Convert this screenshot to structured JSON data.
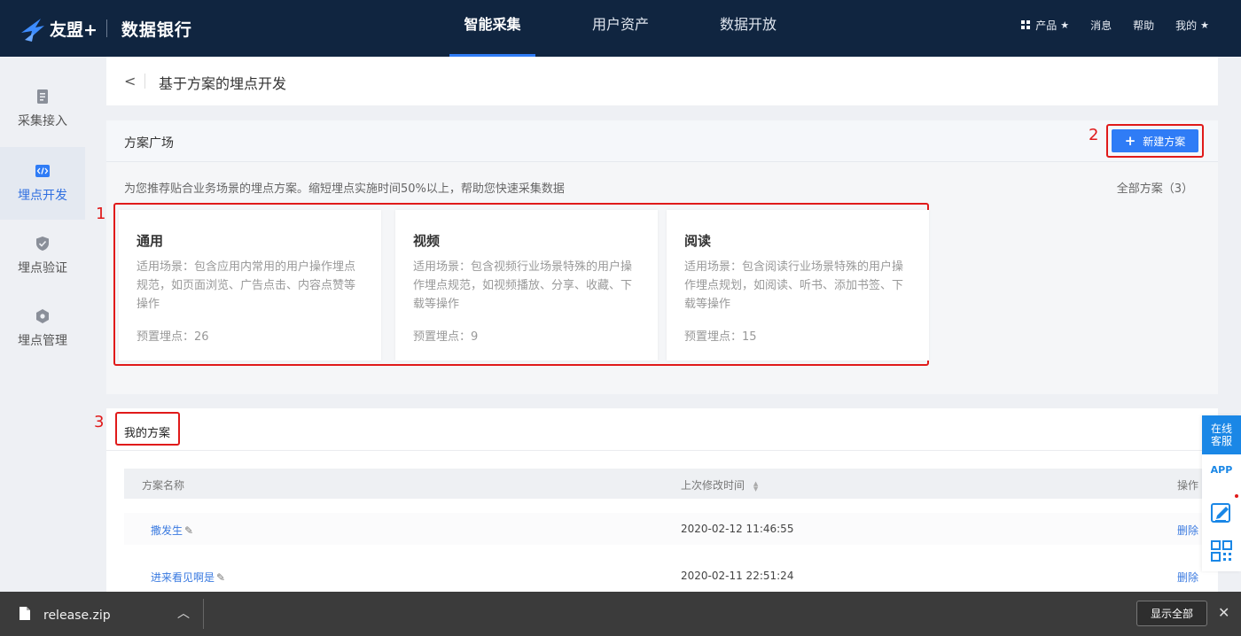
{
  "topnav": {
    "logo_text": "友盟+",
    "product_name": "数据银行",
    "tabs": [
      {
        "label": "智能采集",
        "active": true
      },
      {
        "label": "用户资产",
        "active": false
      },
      {
        "label": "数据开放",
        "active": false
      }
    ],
    "right": {
      "product": "产品",
      "messages": "消息",
      "help": "帮助",
      "mine": "我的"
    }
  },
  "sidebar": {
    "items": [
      {
        "label": "采集接入",
        "icon": "document-icon",
        "active": false
      },
      {
        "label": "埋点开发",
        "icon": "code-icon",
        "active": true
      },
      {
        "label": "埋点验证",
        "icon": "shield-check-icon",
        "active": false
      },
      {
        "label": "埋点管理",
        "icon": "settings-hex-icon",
        "active": false
      }
    ]
  },
  "breadcrumb": {
    "title": "基于方案的埋点开发"
  },
  "square": {
    "title": "方案广场",
    "new_button": "新建方案",
    "description": "为您推荐贴合业务场景的埋点方案。缩短埋点实施时间50%以上，帮助您快速采集数据",
    "all_link": "全部方案（3）",
    "cards": [
      {
        "title": "通用",
        "desc": "适用场景：包含应用内常用的用户操作埋点规范，如页面浏览、广告点击、内容点赞等操作",
        "count": "预置埋点：26"
      },
      {
        "title": "视频",
        "desc": "适用场景：包含视频行业场景特殊的用户操作埋点规范，如视频播放、分享、收藏、下载等操作",
        "count": "预置埋点：9"
      },
      {
        "title": "阅读",
        "desc": "适用场景：包含阅读行业场景特殊的用户操作埋点规划，如阅读、听书、添加书签、下载等操作",
        "count": "预置埋点：15"
      }
    ]
  },
  "mine": {
    "title": "我的方案",
    "columns": {
      "name": "方案名称",
      "time": "上次修改时间",
      "op": "操作"
    },
    "rows": [
      {
        "name": "撒发生",
        "time": "2020-02-12 11:46:55",
        "op": "删除"
      },
      {
        "name": "进来看见啊是",
        "time": "2020-02-11 22:51:24",
        "op": "删除"
      }
    ]
  },
  "annotations": {
    "a1": "1",
    "a2": "2",
    "a3": "3"
  },
  "floatbar": {
    "service": "在线客服",
    "app": "APP"
  },
  "download": {
    "filename": "release.zip",
    "show_all": "显示全部"
  },
  "colors": {
    "nav_bg": "#102540",
    "accent": "#2f7cf6",
    "highlight_red": "#e01a1a",
    "link_blue": "#3a7ae0"
  }
}
